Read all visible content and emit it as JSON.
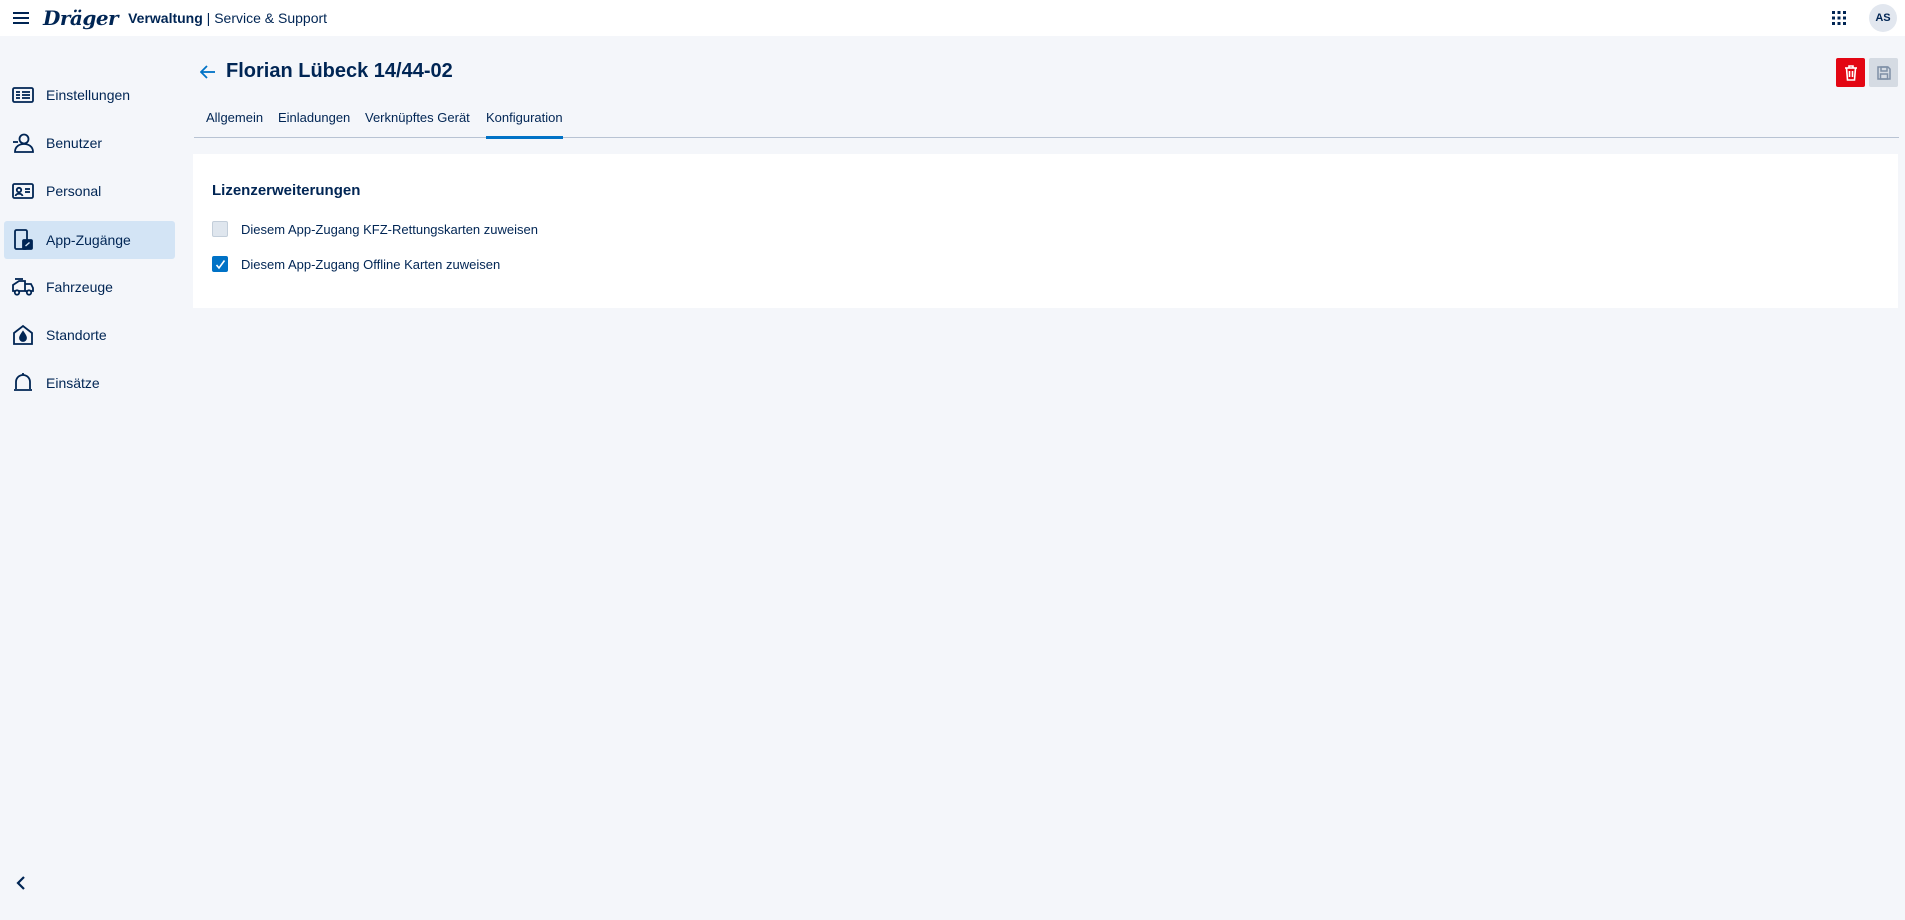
{
  "header": {
    "brand": "Dräger",
    "app_name": "Verwaltung",
    "separator": " | ",
    "app_section": "Service & Support",
    "avatar_initials": "AS"
  },
  "sidebar": {
    "items": [
      {
        "label": "Einstellungen",
        "icon": "settings-list-icon",
        "active": false
      },
      {
        "label": "Benutzer",
        "icon": "user-icon",
        "active": false
      },
      {
        "label": "Personal",
        "icon": "id-card-icon",
        "active": false
      },
      {
        "label": "App-Zugänge",
        "icon": "app-access-icon",
        "active": true
      },
      {
        "label": "Fahrzeuge",
        "icon": "vehicle-icon",
        "active": false
      },
      {
        "label": "Standorte",
        "icon": "location-icon",
        "active": false
      },
      {
        "label": "Einsätze",
        "icon": "bell-icon",
        "active": false
      }
    ]
  },
  "page": {
    "title": "Florian Lübeck 14/44-02"
  },
  "tabs": [
    {
      "label": "Allgemein",
      "active": false
    },
    {
      "label": "Einladungen",
      "active": false
    },
    {
      "label": "Verknüpftes Gerät",
      "active": false
    },
    {
      "label": "Konfiguration",
      "active": true
    }
  ],
  "license_section": {
    "title": "Lizenzerweiterungen",
    "options": [
      {
        "label": "Diesem App-Zugang KFZ-Rettungskarten zuweisen",
        "checked": false
      },
      {
        "label": "Diesem App-Zugang Offline Karten zuweisen",
        "checked": true
      }
    ]
  },
  "colors": {
    "accent": "#0072c6",
    "danger": "#e30613",
    "text": "#002554",
    "active_nav_bg": "#d3e4f5"
  }
}
